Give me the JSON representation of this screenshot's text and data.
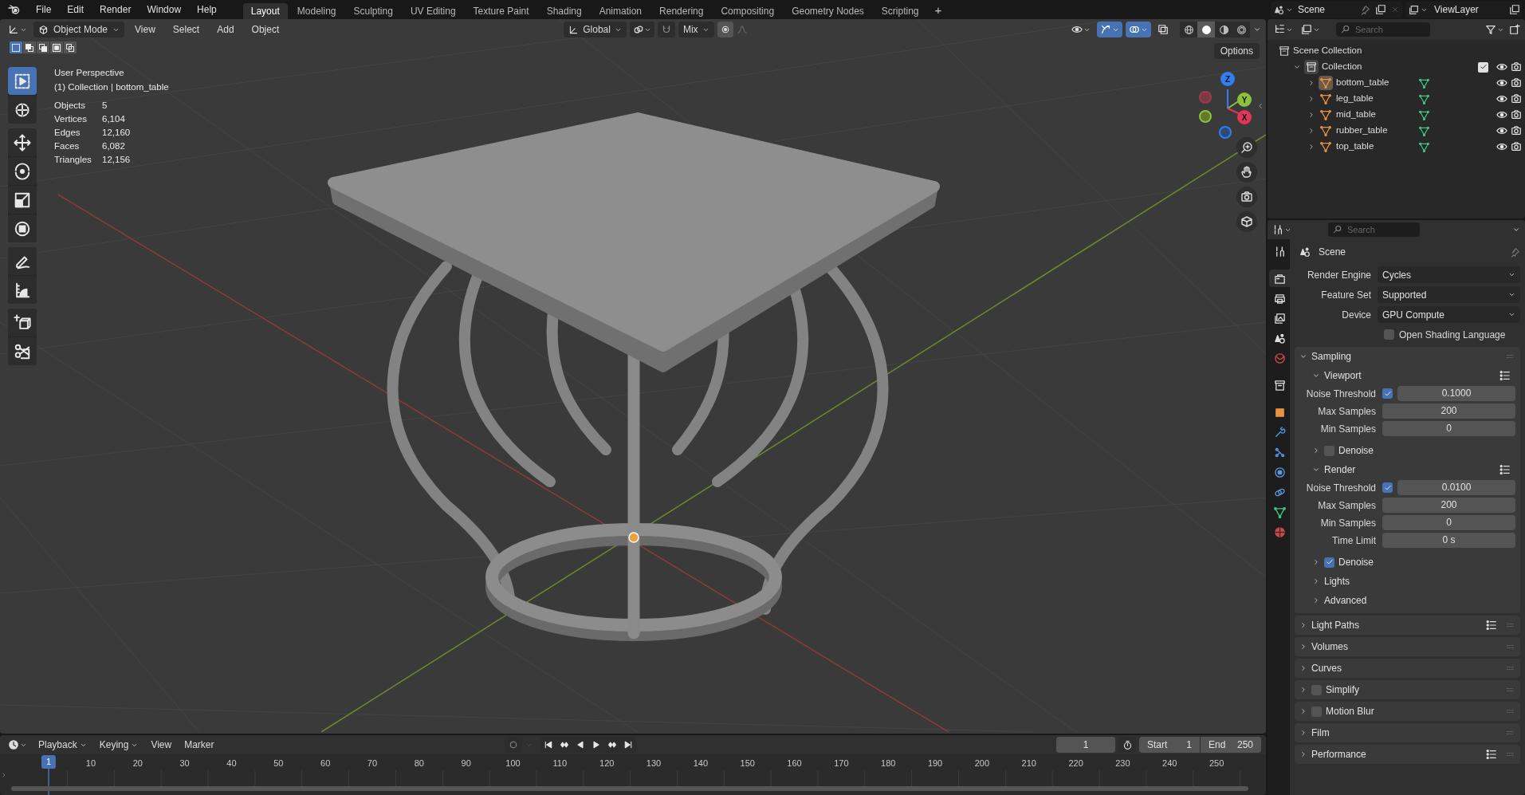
{
  "top_bar": {
    "menus": [
      "File",
      "Edit",
      "Render",
      "Window",
      "Help"
    ],
    "workspaces": [
      {
        "label": "Layout",
        "selected": true
      },
      {
        "label": "Modeling",
        "selected": false
      },
      {
        "label": "Sculpting",
        "selected": false
      },
      {
        "label": "UV Editing",
        "selected": false
      },
      {
        "label": "Texture Paint",
        "selected": false
      },
      {
        "label": "Shading",
        "selected": false
      },
      {
        "label": "Animation",
        "selected": false
      },
      {
        "label": "Rendering",
        "selected": false
      },
      {
        "label": "Compositing",
        "selected": false
      },
      {
        "label": "Geometry Nodes",
        "selected": false
      },
      {
        "label": "Scripting",
        "selected": false
      }
    ],
    "add_workspace": "+",
    "scene": "Scene",
    "view_layer": "ViewLayer"
  },
  "viewport": {
    "header": {
      "mode": "Object Mode",
      "menus": [
        "View",
        "Select",
        "Add",
        "Object"
      ],
      "orientation": "Global",
      "snap_target": "Mix",
      "options": "Options",
      "toggles": [
        {
          "kind": "visibility",
          "on": false
        },
        {
          "kind": "gizmos",
          "on": true
        },
        {
          "kind": "overlays",
          "on": true
        },
        {
          "kind": "xray",
          "on": false
        }
      ],
      "shading": [
        {
          "kind": "wireframe",
          "selected": false
        },
        {
          "kind": "solid",
          "selected": true
        },
        {
          "kind": "material",
          "selected": false
        },
        {
          "kind": "rendered",
          "selected": false
        }
      ]
    },
    "select_modes": [
      {
        "kind": "new",
        "selected": true
      },
      {
        "kind": "extend",
        "selected": false
      },
      {
        "kind": "subtract",
        "selected": false
      },
      {
        "kind": "invert",
        "selected": false
      },
      {
        "kind": "intersect",
        "selected": false
      }
    ],
    "toolbar": [
      [
        {
          "kind": "select_box",
          "selected": true
        },
        {
          "kind": "cursor",
          "selected": false
        }
      ],
      [
        {
          "kind": "move",
          "selected": false
        },
        {
          "kind": "rotate",
          "selected": false
        },
        {
          "kind": "scale",
          "selected": false
        },
        {
          "kind": "transform",
          "selected": false
        }
      ],
      [
        {
          "kind": "annotate",
          "selected": false
        },
        {
          "kind": "measure",
          "selected": false
        }
      ],
      [
        {
          "kind": "add_cube",
          "selected": false
        },
        {
          "kind": "cut",
          "selected": false
        }
      ]
    ],
    "overlay_title": "User Perspective",
    "overlay_context": "(1) Collection | bottom_table",
    "stats": [
      {
        "label": "Objects",
        "value": "5"
      },
      {
        "label": "Vertices",
        "value": "6,104"
      },
      {
        "label": "Edges",
        "value": "12,160"
      },
      {
        "label": "Faces",
        "value": "6,082"
      },
      {
        "label": "Triangles",
        "value": "12,156"
      }
    ],
    "gizmo_axes": [
      {
        "label": "Z",
        "color": "#2f7ff0"
      },
      {
        "label": "Y",
        "color": "#8bc13b"
      },
      {
        "label": "X",
        "color": "#e0365a"
      }
    ]
  },
  "outliner": {
    "search_placeholder": "Search",
    "tree": [
      {
        "label": "Scene Collection",
        "kind": "scene_collection",
        "children": [
          {
            "label": "Collection",
            "kind": "collection",
            "expanded": true,
            "checked": true,
            "children": [
              {
                "label": "bottom_table",
                "kind": "object",
                "active": true,
                "expanded": false
              },
              {
                "label": "leg_table",
                "kind": "object",
                "active": false,
                "expanded": false
              },
              {
                "label": "mid_table",
                "kind": "object",
                "active": false,
                "expanded": false
              },
              {
                "label": "rubber_table",
                "kind": "object",
                "active": false,
                "expanded": false
              },
              {
                "label": "top_table",
                "kind": "object",
                "active": false,
                "expanded": false
              }
            ]
          }
        ]
      }
    ]
  },
  "properties": {
    "search_placeholder": "Search",
    "context": "Scene",
    "tabs": [
      {
        "kind": "tool",
        "selected": false
      },
      {
        "kind": "render",
        "selected": true
      },
      {
        "kind": "output",
        "selected": false
      },
      {
        "kind": "view_layer",
        "selected": false
      },
      {
        "kind": "scene",
        "selected": false
      },
      {
        "kind": "world",
        "selected": false
      },
      {
        "kind": "collection",
        "selected": false
      },
      {
        "kind": "object",
        "selected": false
      },
      {
        "kind": "modifiers",
        "selected": false
      },
      {
        "kind": "particles",
        "selected": false
      },
      {
        "kind": "physics",
        "selected": false
      },
      {
        "kind": "constraints",
        "selected": false
      },
      {
        "kind": "data",
        "selected": false
      },
      {
        "kind": "material",
        "selected": false
      }
    ],
    "rows": [
      {
        "kind": "dropdown",
        "label": "Render Engine",
        "value": "Cycles"
      },
      {
        "kind": "dropdown",
        "label": "Feature Set",
        "value": "Supported"
      },
      {
        "kind": "dropdown",
        "label": "Device",
        "value": "GPU Compute"
      },
      {
        "kind": "checkbox",
        "label": "Open Shading Language",
        "checked": false
      },
      {
        "kind": "panel",
        "label": "Sampling",
        "expanded": true,
        "children": [
          {
            "kind": "subpanel",
            "label": "Viewport",
            "expanded": true,
            "presets": true,
            "children": [
              {
                "kind": "check_number",
                "label": "Noise Threshold",
                "checked": true,
                "value": "0.1000"
              },
              {
                "kind": "number",
                "label": "Max Samples",
                "value": "200"
              },
              {
                "kind": "number",
                "label": "Min Samples",
                "value": "0"
              }
            ]
          },
          {
            "kind": "subpanel",
            "label": "Denoise",
            "expanded": false,
            "checked": false
          },
          {
            "kind": "subpanel",
            "label": "Render",
            "expanded": true,
            "presets": true,
            "children": [
              {
                "kind": "check_number",
                "label": "Noise Threshold",
                "checked": true,
                "value": "0.0100"
              },
              {
                "kind": "number",
                "label": "Max Samples",
                "value": "200"
              },
              {
                "kind": "number",
                "label": "Min Samples",
                "value": "0"
              },
              {
                "kind": "number",
                "label": "Time Limit",
                "value": "0 s"
              }
            ]
          },
          {
            "kind": "subpanel",
            "label": "Denoise",
            "expanded": false,
            "checked": true
          },
          {
            "kind": "subpanel",
            "label": "Lights",
            "expanded": false
          },
          {
            "kind": "subpanel",
            "label": "Advanced",
            "expanded": false
          }
        ]
      },
      {
        "kind": "panel",
        "label": "Light Paths",
        "expanded": false,
        "presets": true
      },
      {
        "kind": "panel",
        "label": "Volumes",
        "expanded": false
      },
      {
        "kind": "panel",
        "label": "Curves",
        "expanded": false
      },
      {
        "kind": "panel",
        "label": "Simplify",
        "expanded": false,
        "checked": false
      },
      {
        "kind": "panel",
        "label": "Motion Blur",
        "expanded": false,
        "checked": false
      },
      {
        "kind": "panel",
        "label": "Film",
        "expanded": false
      },
      {
        "kind": "panel",
        "label": "Performance",
        "expanded": false,
        "presets": true
      }
    ]
  },
  "timeline": {
    "menus": [
      {
        "label": "Playback",
        "dropdown": true
      },
      {
        "label": "Keying",
        "dropdown": true
      },
      {
        "label": "View",
        "dropdown": false
      },
      {
        "label": "Marker",
        "dropdown": false
      }
    ],
    "current_frame": "1",
    "start_label": "Start",
    "start": "1",
    "end_label": "End",
    "end": "250",
    "playhead_label": "1",
    "ruler_labels": [
      "10",
      "20",
      "30",
      "40",
      "50",
      "60",
      "70",
      "80",
      "90",
      "100",
      "110",
      "120",
      "130",
      "140",
      "150",
      "160",
      "170",
      "180",
      "190",
      "200",
      "210",
      "220",
      "230",
      "240",
      "250"
    ]
  }
}
